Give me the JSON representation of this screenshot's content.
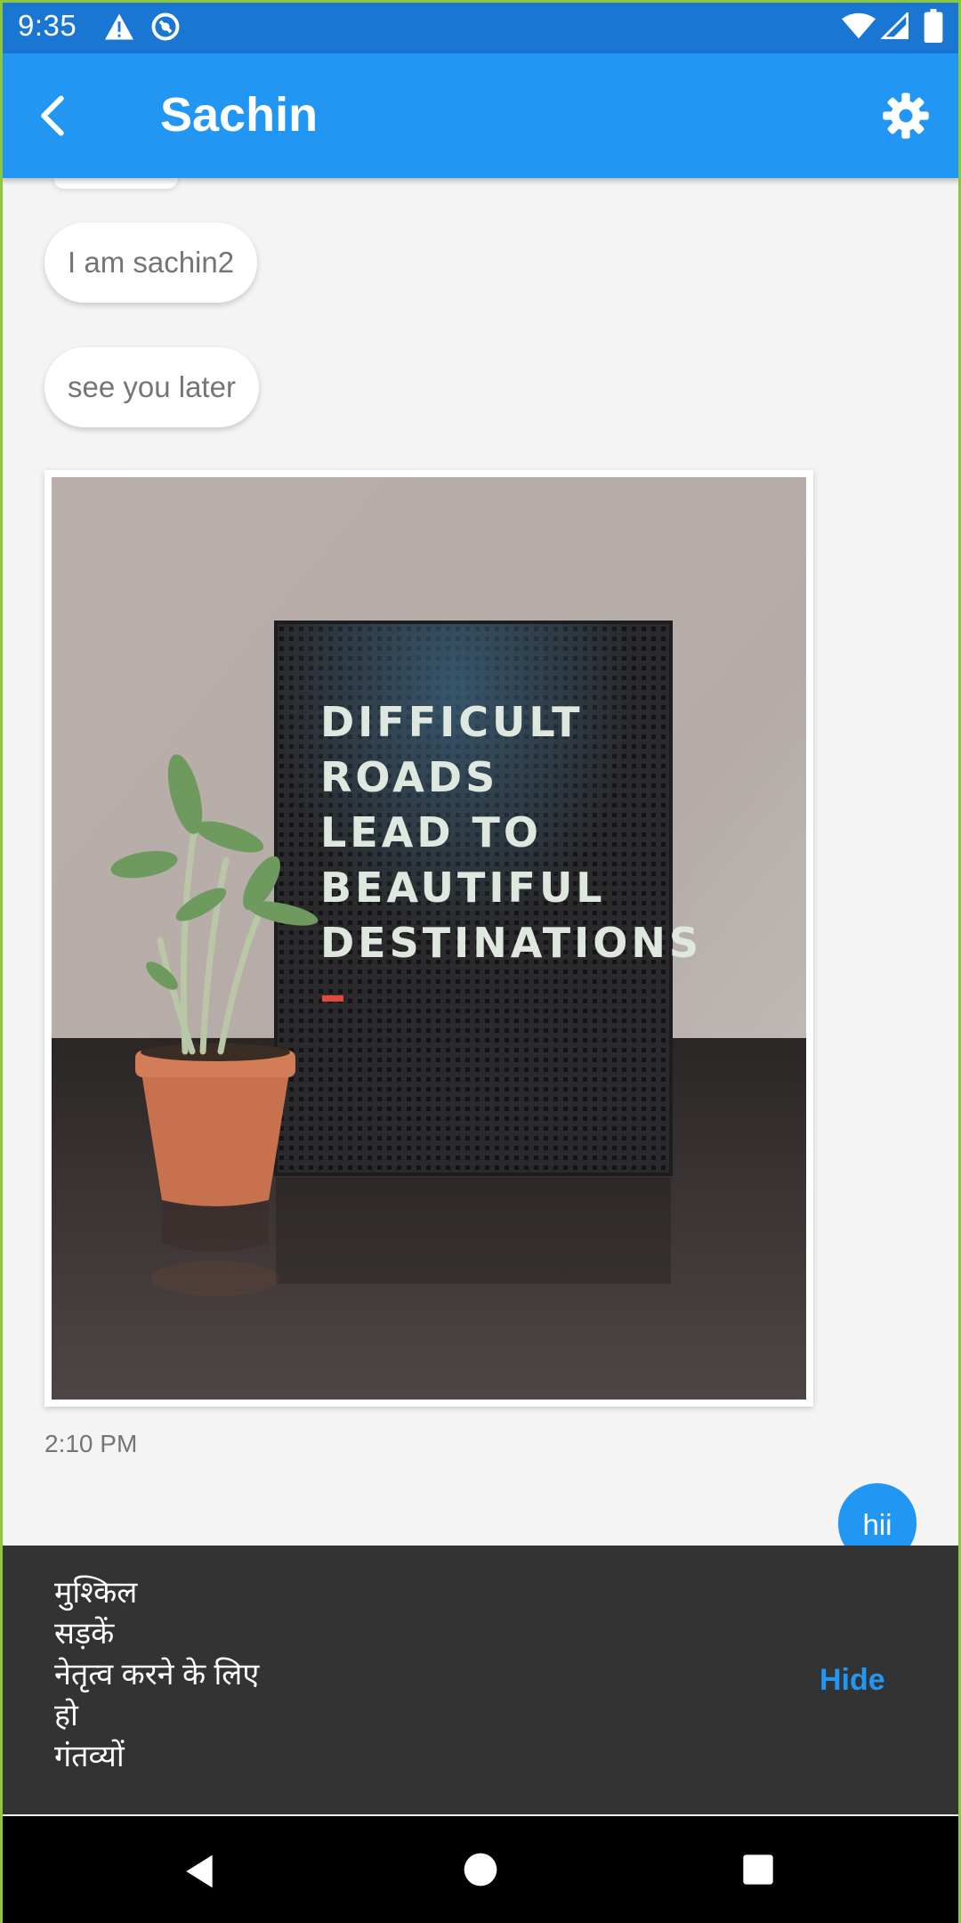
{
  "status_bar": {
    "time": "9:35",
    "icons": [
      "warning-icon",
      "sync-icon",
      "wifi-icon",
      "cell-signal-icon",
      "battery-icon"
    ]
  },
  "app_bar": {
    "title": "Sachin",
    "back_icon": "back-arrow-icon",
    "settings_icon": "gear-icon",
    "color": "#2196f3"
  },
  "messages": {
    "incoming": [
      {
        "text": "I am sachin2"
      },
      {
        "text": "see you later"
      }
    ],
    "image_message": {
      "board_text": [
        "DIFFICULT",
        "ROADS",
        "LEAD TO",
        "BEAUTIFUL",
        "DESTINATIONS"
      ],
      "time": "2:10 PM"
    },
    "outgoing": [
      {
        "text": "hii"
      }
    ]
  },
  "snackbar": {
    "lines": [
      "मुश्किल",
      "सड़कें",
      "नेतृत्व करने के लिए",
      "हो",
      "गंतव्यों"
    ],
    "action": "Hide",
    "action_color": "#2196f3"
  },
  "nav_bar": {
    "icons": [
      "nav-back-icon",
      "nav-home-icon",
      "nav-recents-icon"
    ]
  }
}
